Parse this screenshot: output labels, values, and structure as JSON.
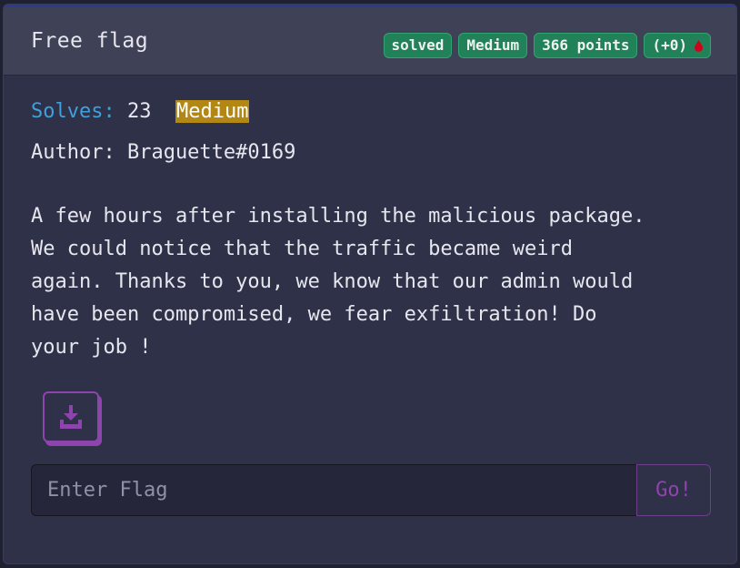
{
  "challenge": {
    "title": "Free flag",
    "badges": {
      "status": "solved",
      "difficulty": "Medium",
      "points": "366 points",
      "bonus": "(+0)",
      "bonus_icon": "blood-drop-icon"
    },
    "solves_label": "Solves:",
    "solves_count": "23",
    "difficulty_tag": "Medium",
    "author": "Author: Braguette#0169",
    "description": "A few hours after installing the malicious package.\nWe could notice that the traffic became weird\nagain. Thanks to you, we know that our admin would\nhave been compromised, we fear exfiltration! Do\nyour job !"
  },
  "download": {
    "icon": "download-icon"
  },
  "flag_form": {
    "placeholder": "Enter Flag",
    "value": "",
    "submit_label": "Go!"
  },
  "colors": {
    "badge_green": "#218159",
    "solves_label_blue": "#3fa0dc",
    "difficulty_gold": "#b38714",
    "accent_purple": "#8e44ad",
    "blood_red": "#d0021b"
  }
}
